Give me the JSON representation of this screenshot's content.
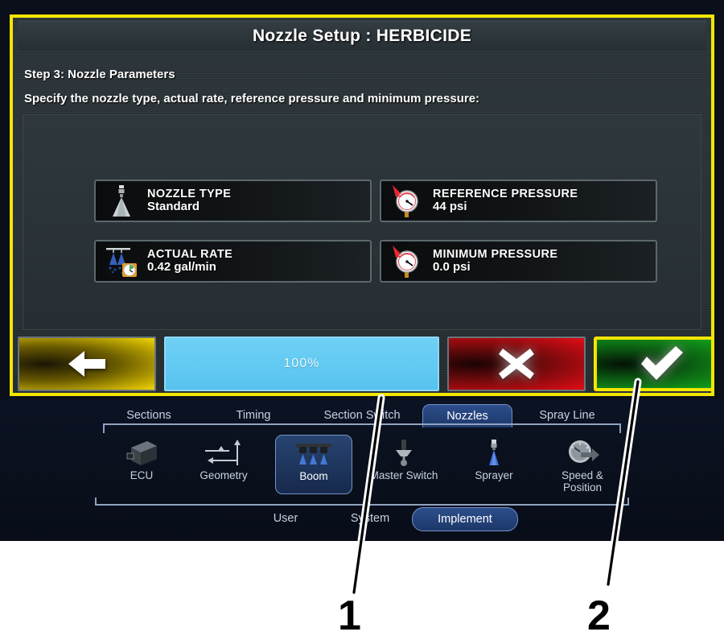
{
  "dialog": {
    "title": "Nozzle Setup : HERBICIDE",
    "step": "Step 3: Nozzle Parameters",
    "description": "Specify the nozzle type, actual rate, reference pressure and minimum pressure:",
    "cards": [
      {
        "label": "NOZZLE TYPE",
        "value": "Standard",
        "icon": "spray-nozzle-icon"
      },
      {
        "label": "REFERENCE PRESSURE",
        "value": "44 psi",
        "icon": "pressure-gauge-icon"
      },
      {
        "label": "ACTUAL RATE",
        "value": "0.42 gal/min",
        "icon": "spray-rate-meter-icon"
      },
      {
        "label": "MINIMUM PRESSURE",
        "value": "0.0 psi",
        "icon": "pressure-gauge-icon"
      }
    ],
    "buttons": {
      "back": {
        "icon": "back-arrow-icon",
        "label": ""
      },
      "progress": {
        "label": "100%"
      },
      "cancel": {
        "icon": "x-cross-icon",
        "label": ""
      },
      "accept": {
        "icon": "check-mark-icon",
        "label": ""
      }
    }
  },
  "navigation": {
    "tabs": [
      {
        "label": "Sections",
        "selected": false
      },
      {
        "label": "Timing",
        "selected": false
      },
      {
        "label": "Section Switch",
        "selected": false
      },
      {
        "label": "Nozzles",
        "selected": true
      },
      {
        "label": "Spray Line",
        "selected": false
      }
    ],
    "icons": [
      {
        "label": "ECU",
        "icon": "ecu-box-icon",
        "selected": false
      },
      {
        "label": "Geometry",
        "icon": "geometry-axes-icon",
        "selected": false
      },
      {
        "label": "Boom",
        "icon": "boom-nozzles-icon",
        "selected": true
      },
      {
        "label": "Master Switch",
        "icon": "master-switch-icon",
        "selected": false
      },
      {
        "label": "Sprayer",
        "icon": "sprayer-nozzle-icon",
        "selected": false
      },
      {
        "label": "Speed & Position",
        "icon": "speedometer-arrow-icon",
        "selected": false
      }
    ],
    "bottom": [
      {
        "label": "User",
        "selected": false
      },
      {
        "label": "System",
        "selected": false
      },
      {
        "label": "Implement",
        "selected": true
      }
    ]
  },
  "callouts": [
    {
      "number": "1"
    },
    {
      "number": "2"
    }
  ],
  "colors": {
    "highlight_border": "#f2e600",
    "progress_fill": "#62c9f2",
    "cancel_red": "#e20c15",
    "accept_green": "#13a81c",
    "back_yellow": "#f2d500",
    "selected_blue": "#2d4e8c"
  }
}
